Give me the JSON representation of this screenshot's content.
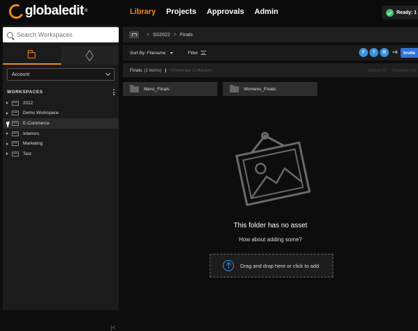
{
  "app": {
    "logo_text": "globaledit",
    "logo_tm": "®"
  },
  "nav": {
    "items": [
      "Library",
      "Projects",
      "Approvals",
      "Admin"
    ],
    "active": "Library"
  },
  "status": {
    "label": "Ready: 1"
  },
  "sidebar": {
    "search_placeholder": "Search Workspaces",
    "account_label": "Account",
    "workspaces_header": "WORKSPACES",
    "workspaces": [
      {
        "label": "2022"
      },
      {
        "label": "Demo Workspace"
      },
      {
        "label": "E-Commerce"
      },
      {
        "label": "Interiors"
      },
      {
        "label": "Marketing"
      },
      {
        "label": "Test"
      }
    ],
    "collapse_glyph": "|<"
  },
  "breadcrumb": {
    "items": [
      "SS2022",
      "Finals"
    ],
    "separator": ">"
  },
  "toolbar": {
    "sort_label": "Sort By: Filename",
    "filter_label": "Filter",
    "avatars": [
      "F",
      "T",
      "R"
    ],
    "avatar_more": "+4",
    "invite_label": "Invite"
  },
  "finals_bar": {
    "title": "Finals",
    "count": "(2 items)",
    "pipe": "|",
    "generate_label": "+Generate Collection",
    "select_all": "Select All",
    "deselect_all": "Deselect All"
  },
  "folders": [
    {
      "label": "Mens_Finals"
    },
    {
      "label": "Womens_Finals"
    }
  ],
  "empty_state": {
    "title": "This folder has no asset",
    "subtitle": "How about adding some?",
    "dropzone_label": "Drag and drop here or click to add"
  },
  "colors": {
    "accent": "#f08a1c",
    "invite": "#2f73d8",
    "avatar": "#3d8fe0",
    "ready": "#3ec46d"
  }
}
